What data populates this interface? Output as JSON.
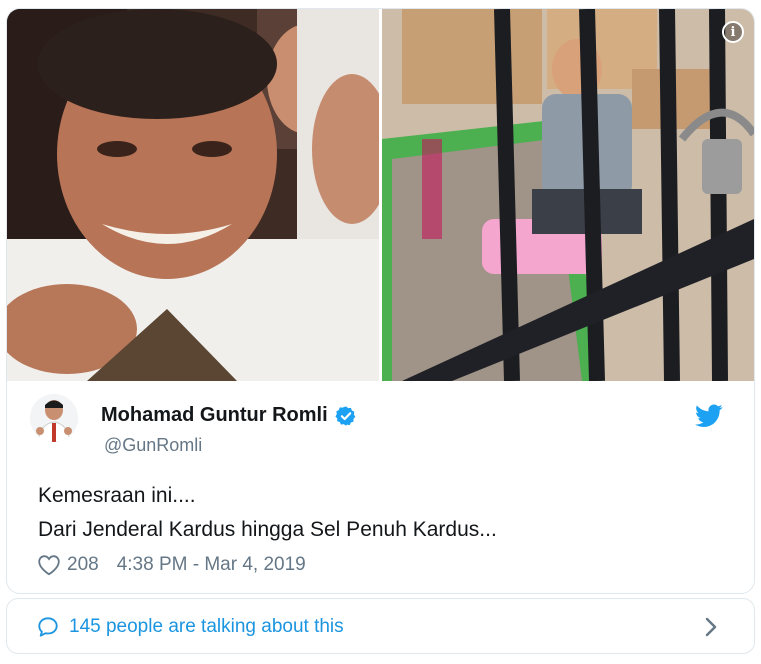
{
  "tweet": {
    "author_name": "Mohamad Guntur Romli",
    "author_handle": "@GunRomli",
    "text_lines": [
      "Kemesraan ini....",
      "Dari Jenderal Kardus hingga Sel Penuh Kardus..."
    ],
    "likes": "208",
    "timestamp": "4:38 PM - Mar 4, 2019",
    "talking": "145 people are talking about this"
  },
  "icons": {
    "info": "info-icon",
    "verified": "verified-badge-icon",
    "brand": "twitter-bird-icon",
    "like": "heart-icon",
    "conversation": "speech-bubble-icon",
    "expand": "chevron-right-icon"
  },
  "colors": {
    "accent": "#1da1f2",
    "link": "#1b95e0",
    "secondary_text": "#657786",
    "border": "#e1e8ed"
  }
}
